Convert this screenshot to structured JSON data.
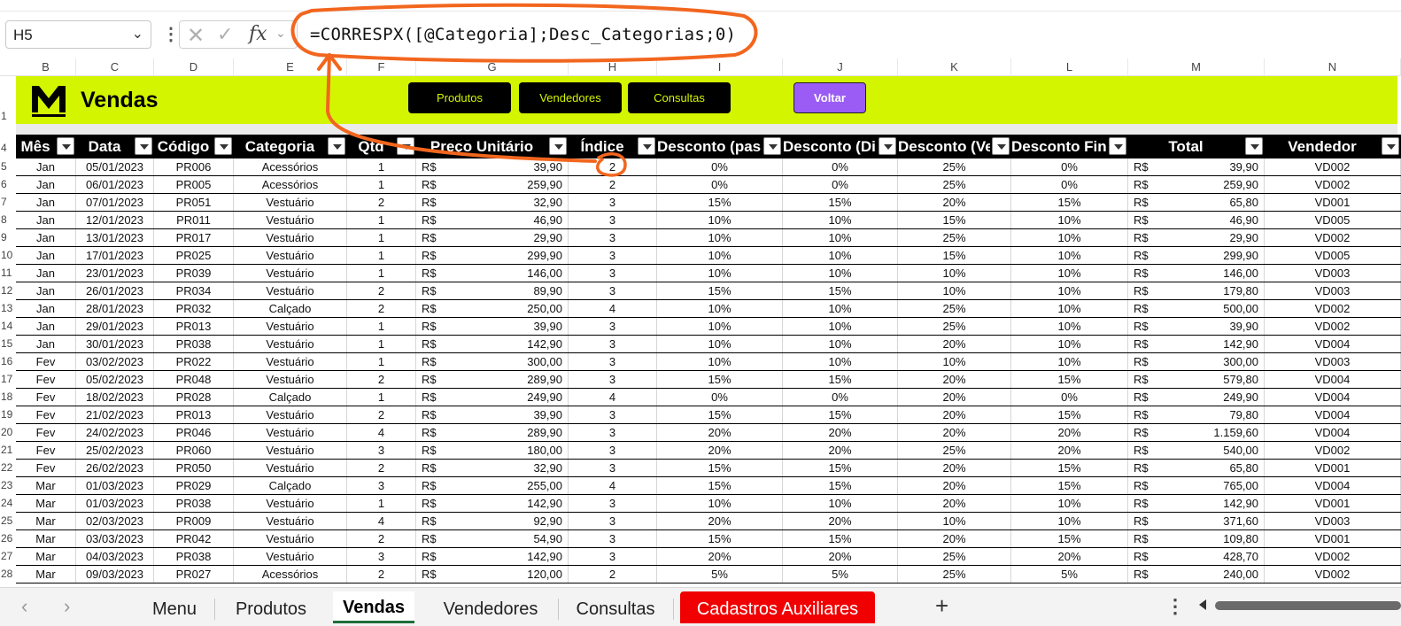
{
  "formula_bar": {
    "name_box": "H5",
    "formula": "=CORRESPX([@Categoria];Desc_Categorias;0)",
    "fx_label": "fx"
  },
  "column_letters": [
    "B",
    "C",
    "D",
    "E",
    "F",
    "G",
    "H",
    "I",
    "J",
    "K",
    "L",
    "M",
    "N"
  ],
  "banner": {
    "title": "Vendas",
    "buttons": [
      "Produtos",
      "Vendedores",
      "Consultas"
    ],
    "back_button": "Voltar",
    "accent_color": "#d4f500",
    "back_color": "#9a5cf5"
  },
  "table": {
    "headers": [
      "Mês",
      "Data",
      "Código",
      "Categoria",
      "Qtd",
      "Preço Unitário",
      "Índice",
      "Desconto (passo a passo)",
      "Desconto (Direto)",
      "Desconto (Vendedor)",
      "Desconto Final",
      "Total",
      "Vendedor"
    ],
    "header_row_number": "4",
    "banner_row_number": "1",
    "currency": "R$",
    "rows": [
      {
        "n": "5",
        "mes": "Jan",
        "data": "05/01/2023",
        "cod": "PR006",
        "cat": "Acessórios",
        "qtd": "1",
        "preco": "39,90",
        "idx": "2",
        "d1": "0%",
        "d2": "0%",
        "d3": "25%",
        "df": "0%",
        "total": "39,90",
        "vend": "VD002"
      },
      {
        "n": "6",
        "mes": "Jan",
        "data": "06/01/2023",
        "cod": "PR005",
        "cat": "Acessórios",
        "qtd": "1",
        "preco": "259,90",
        "idx": "2",
        "d1": "0%",
        "d2": "0%",
        "d3": "25%",
        "df": "0%",
        "total": "259,90",
        "vend": "VD002"
      },
      {
        "n": "7",
        "mes": "Jan",
        "data": "07/01/2023",
        "cod": "PR051",
        "cat": "Vestuário",
        "qtd": "2",
        "preco": "32,90",
        "idx": "3",
        "d1": "15%",
        "d2": "15%",
        "d3": "20%",
        "df": "15%",
        "total": "65,80",
        "vend": "VD001"
      },
      {
        "n": "8",
        "mes": "Jan",
        "data": "12/01/2023",
        "cod": "PR011",
        "cat": "Vestuário",
        "qtd": "1",
        "preco": "46,90",
        "idx": "3",
        "d1": "10%",
        "d2": "10%",
        "d3": "15%",
        "df": "10%",
        "total": "46,90",
        "vend": "VD005"
      },
      {
        "n": "9",
        "mes": "Jan",
        "data": "13/01/2023",
        "cod": "PR017",
        "cat": "Vestuário",
        "qtd": "1",
        "preco": "29,90",
        "idx": "3",
        "d1": "10%",
        "d2": "10%",
        "d3": "25%",
        "df": "10%",
        "total": "29,90",
        "vend": "VD002"
      },
      {
        "n": "10",
        "mes": "Jan",
        "data": "17/01/2023",
        "cod": "PR025",
        "cat": "Vestuário",
        "qtd": "1",
        "preco": "299,90",
        "idx": "3",
        "d1": "10%",
        "d2": "10%",
        "d3": "15%",
        "df": "10%",
        "total": "299,90",
        "vend": "VD005"
      },
      {
        "n": "11",
        "mes": "Jan",
        "data": "23/01/2023",
        "cod": "PR039",
        "cat": "Vestuário",
        "qtd": "1",
        "preco": "146,00",
        "idx": "3",
        "d1": "10%",
        "d2": "10%",
        "d3": "10%",
        "df": "10%",
        "total": "146,00",
        "vend": "VD003"
      },
      {
        "n": "12",
        "mes": "Jan",
        "data": "26/01/2023",
        "cod": "PR034",
        "cat": "Vestuário",
        "qtd": "2",
        "preco": "89,90",
        "idx": "3",
        "d1": "15%",
        "d2": "15%",
        "d3": "10%",
        "df": "10%",
        "total": "179,80",
        "vend": "VD003"
      },
      {
        "n": "13",
        "mes": "Jan",
        "data": "28/01/2023",
        "cod": "PR032",
        "cat": "Calçado",
        "qtd": "2",
        "preco": "250,00",
        "idx": "4",
        "d1": "10%",
        "d2": "10%",
        "d3": "25%",
        "df": "10%",
        "total": "500,00",
        "vend": "VD002"
      },
      {
        "n": "14",
        "mes": "Jan",
        "data": "29/01/2023",
        "cod": "PR013",
        "cat": "Vestuário",
        "qtd": "1",
        "preco": "39,90",
        "idx": "3",
        "d1": "10%",
        "d2": "10%",
        "d3": "25%",
        "df": "10%",
        "total": "39,90",
        "vend": "VD002"
      },
      {
        "n": "15",
        "mes": "Jan",
        "data": "30/01/2023",
        "cod": "PR038",
        "cat": "Vestuário",
        "qtd": "1",
        "preco": "142,90",
        "idx": "3",
        "d1": "10%",
        "d2": "10%",
        "d3": "20%",
        "df": "10%",
        "total": "142,90",
        "vend": "VD004"
      },
      {
        "n": "16",
        "mes": "Fev",
        "data": "03/02/2023",
        "cod": "PR022",
        "cat": "Vestuário",
        "qtd": "1",
        "preco": "300,00",
        "idx": "3",
        "d1": "10%",
        "d2": "10%",
        "d3": "10%",
        "df": "10%",
        "total": "300,00",
        "vend": "VD003"
      },
      {
        "n": "17",
        "mes": "Fev",
        "data": "05/02/2023",
        "cod": "PR048",
        "cat": "Vestuário",
        "qtd": "2",
        "preco": "289,90",
        "idx": "3",
        "d1": "15%",
        "d2": "15%",
        "d3": "20%",
        "df": "15%",
        "total": "579,80",
        "vend": "VD004"
      },
      {
        "n": "18",
        "mes": "Fev",
        "data": "18/02/2023",
        "cod": "PR028",
        "cat": "Calçado",
        "qtd": "1",
        "preco": "249,90",
        "idx": "4",
        "d1": "0%",
        "d2": "0%",
        "d3": "20%",
        "df": "0%",
        "total": "249,90",
        "vend": "VD004"
      },
      {
        "n": "19",
        "mes": "Fev",
        "data": "21/02/2023",
        "cod": "PR013",
        "cat": "Vestuário",
        "qtd": "2",
        "preco": "39,90",
        "idx": "3",
        "d1": "15%",
        "d2": "15%",
        "d3": "20%",
        "df": "15%",
        "total": "79,80",
        "vend": "VD004"
      },
      {
        "n": "20",
        "mes": "Fev",
        "data": "24/02/2023",
        "cod": "PR046",
        "cat": "Vestuário",
        "qtd": "4",
        "preco": "289,90",
        "idx": "3",
        "d1": "20%",
        "d2": "20%",
        "d3": "20%",
        "df": "20%",
        "total": "1.159,60",
        "vend": "VD004"
      },
      {
        "n": "21",
        "mes": "Fev",
        "data": "25/02/2023",
        "cod": "PR060",
        "cat": "Vestuário",
        "qtd": "3",
        "preco": "180,00",
        "idx": "3",
        "d1": "20%",
        "d2": "20%",
        "d3": "25%",
        "df": "20%",
        "total": "540,00",
        "vend": "VD002"
      },
      {
        "n": "22",
        "mes": "Fev",
        "data": "26/02/2023",
        "cod": "PR050",
        "cat": "Vestuário",
        "qtd": "2",
        "preco": "32,90",
        "idx": "3",
        "d1": "15%",
        "d2": "15%",
        "d3": "20%",
        "df": "15%",
        "total": "65,80",
        "vend": "VD001"
      },
      {
        "n": "23",
        "mes": "Mar",
        "data": "01/03/2023",
        "cod": "PR029",
        "cat": "Calçado",
        "qtd": "3",
        "preco": "255,00",
        "idx": "4",
        "d1": "15%",
        "d2": "15%",
        "d3": "20%",
        "df": "15%",
        "total": "765,00",
        "vend": "VD004"
      },
      {
        "n": "24",
        "mes": "Mar",
        "data": "01/03/2023",
        "cod": "PR038",
        "cat": "Vestuário",
        "qtd": "1",
        "preco": "142,90",
        "idx": "3",
        "d1": "10%",
        "d2": "10%",
        "d3": "20%",
        "df": "10%",
        "total": "142,90",
        "vend": "VD001"
      },
      {
        "n": "25",
        "mes": "Mar",
        "data": "02/03/2023",
        "cod": "PR009",
        "cat": "Vestuário",
        "qtd": "4",
        "preco": "92,90",
        "idx": "3",
        "d1": "20%",
        "d2": "20%",
        "d3": "10%",
        "df": "10%",
        "total": "371,60",
        "vend": "VD003"
      },
      {
        "n": "26",
        "mes": "Mar",
        "data": "03/03/2023",
        "cod": "PR042",
        "cat": "Vestuário",
        "qtd": "2",
        "preco": "54,90",
        "idx": "3",
        "d1": "15%",
        "d2": "15%",
        "d3": "20%",
        "df": "15%",
        "total": "109,80",
        "vend": "VD001"
      },
      {
        "n": "27",
        "mes": "Mar",
        "data": "04/03/2023",
        "cod": "PR038",
        "cat": "Vestuário",
        "qtd": "3",
        "preco": "142,90",
        "idx": "3",
        "d1": "20%",
        "d2": "20%",
        "d3": "25%",
        "df": "20%",
        "total": "428,70",
        "vend": "VD002"
      },
      {
        "n": "28",
        "mes": "Mar",
        "data": "09/03/2023",
        "cod": "PR027",
        "cat": "Acessórios",
        "qtd": "2",
        "preco": "120,00",
        "idx": "2",
        "d1": "5%",
        "d2": "5%",
        "d3": "25%",
        "df": "5%",
        "total": "240,00",
        "vend": "VD002"
      }
    ]
  },
  "sheet_tabs": [
    "Menu",
    "Produtos",
    "Vendas",
    "Vendedores",
    "Consultas",
    "Cadastros Auxiliares"
  ],
  "active_tab": "Vendas",
  "highlight_tab": "Cadastros Auxiliares"
}
